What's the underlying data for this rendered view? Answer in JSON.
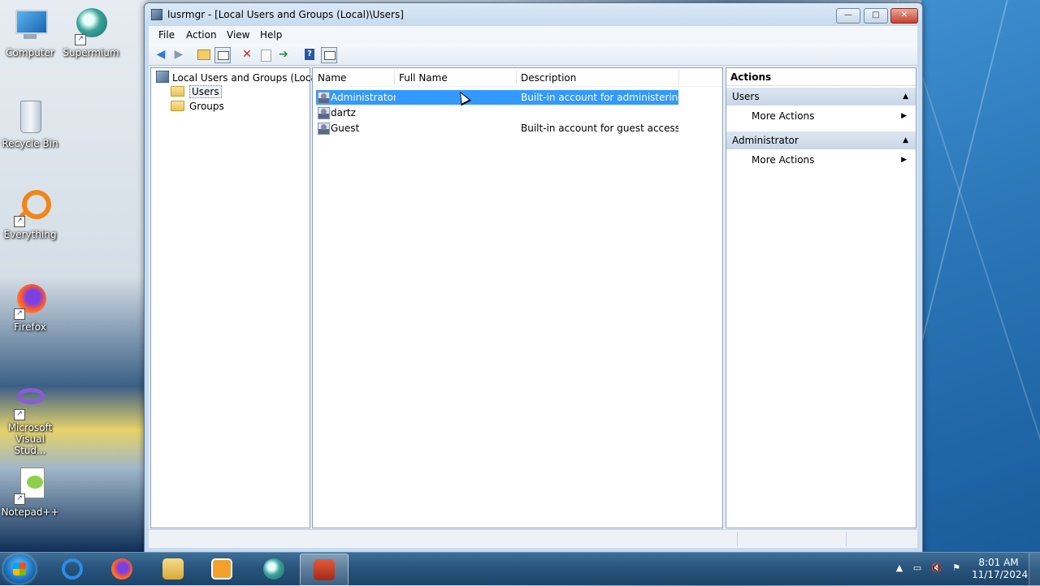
{
  "desktop": {
    "icons": [
      {
        "label": "Computer"
      },
      {
        "label": "Supermium"
      },
      {
        "label": "Recycle Bin"
      },
      {
        "label": "Everything"
      },
      {
        "label": "Firefox"
      },
      {
        "label": "Microsoft Visual Stud..."
      },
      {
        "label": "Notepad++"
      }
    ]
  },
  "window": {
    "title": "lusrmgr - [Local Users and Groups (Local)\\Users]",
    "controls": {
      "minimize": "—",
      "maximize": "□",
      "close": "✕"
    }
  },
  "menu": [
    "File",
    "Action",
    "View",
    "Help"
  ],
  "toolbar": {
    "icons": [
      "back-icon",
      "forward-icon",
      "up-folder-icon",
      "show-hide-tree-icon",
      "delete-icon",
      "properties-icon",
      "export-list-icon",
      "help-icon",
      "show-hide-action-pane-icon"
    ]
  },
  "tree": {
    "root": "Local Users and Groups (Local)",
    "children": [
      {
        "label": "Users",
        "selected": true
      },
      {
        "label": "Groups",
        "selected": false
      }
    ]
  },
  "list": {
    "columns": [
      "Name",
      "Full Name",
      "Description"
    ],
    "rows": [
      {
        "name": "Administrator",
        "full_name": "",
        "description": "Built-in account for administering...",
        "selected": true
      },
      {
        "name": "dartz",
        "full_name": "",
        "description": "",
        "selected": false
      },
      {
        "name": "Guest",
        "full_name": "",
        "description": "Built-in account for guest access t...",
        "selected": false
      }
    ]
  },
  "actions": {
    "title": "Actions",
    "sections": [
      {
        "label": "Users",
        "items": [
          "More Actions"
        ]
      },
      {
        "label": "Administrator",
        "items": [
          "More Actions"
        ]
      }
    ]
  },
  "taskbar": {
    "apps": [
      "internet-explorer-icon",
      "firefox-icon",
      "file-explorer-icon",
      "media-player-icon",
      "supermium-icon",
      "computer-management-icon"
    ],
    "clock": {
      "time": "8:01 AM",
      "date": "11/17/2024"
    }
  },
  "colors": {
    "selection": "#3399ff",
    "accent": "#1d4468"
  }
}
